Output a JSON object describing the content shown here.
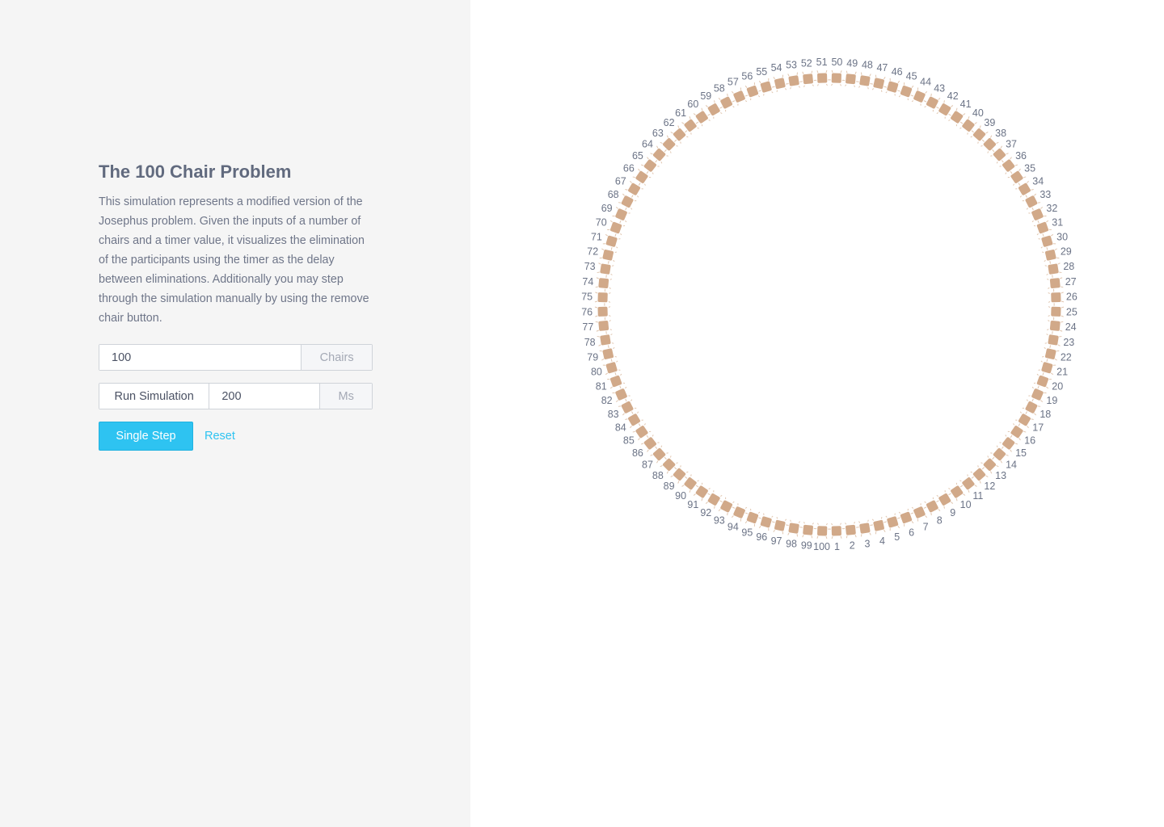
{
  "sidebar": {
    "title": "The 100 Chair Problem",
    "description": "This simulation represents a modified version of the Josephus problem. Given the inputs of a number of chairs and a timer value, it visualizes the elimination of the participants using the timer as the delay between eliminations. Additionally you may step through the simulation manually by using the remove chair button.",
    "chairs_input": {
      "value": "100",
      "addon": "Chairs"
    },
    "run_simulation": {
      "label": "Run Simulation",
      "value": "200",
      "addon": "Ms"
    },
    "single_step_label": "Single Step",
    "reset_label": "Reset"
  },
  "circle": {
    "chair_count": 100,
    "chair_color": "#d1a989",
    "chair_leg_color": "#e0c6b0",
    "label_color": "#6b7386",
    "icon": "chair-icon"
  },
  "colors": {
    "sidebar_bg": "#f5f5f5",
    "title": "#616a7e",
    "text": "#6f7689",
    "accent": "#2ec3f1"
  }
}
